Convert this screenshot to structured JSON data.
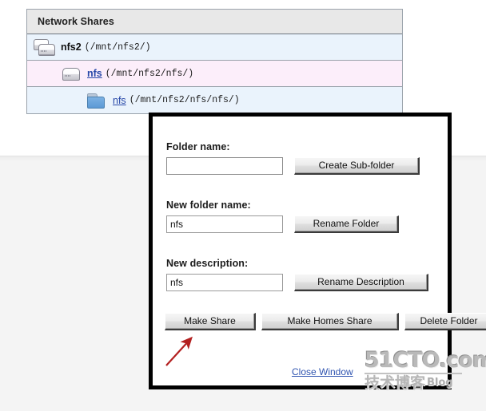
{
  "tree_panel": {
    "header": "Network Shares",
    "rows": [
      {
        "icon": "server-stack-icon",
        "name": "nfs2",
        "path": "(/mnt/nfs2/)",
        "style": "blue",
        "indent": 0,
        "is_link": false
      },
      {
        "icon": "server-icon",
        "name": "nfs",
        "path": "(/mnt/nfs2/nfs/)",
        "style": "pink",
        "indent": 1,
        "is_link": true
      },
      {
        "icon": "folder-icon",
        "name": "nfs",
        "path": "(/mnt/nfs2/nfs/nfs/)",
        "style": "blue",
        "indent": 2,
        "is_link": true
      }
    ]
  },
  "dialog": {
    "folder_name_label": "Folder name:",
    "folder_name_value": "",
    "create_subfolder_label": "Create Sub-folder",
    "new_folder_name_label": "New folder name:",
    "new_folder_name_value": "nfs",
    "rename_folder_label": "Rename Folder",
    "new_description_label": "New description:",
    "new_description_value": "nfs",
    "rename_description_label": "Rename Description",
    "make_share_label": "Make Share",
    "make_homes_share_label": "Make Homes Share",
    "delete_folder_label": "Delete Folder",
    "close_window_label": "Close Window"
  },
  "annotation": {
    "arrow_color": "#b32020"
  },
  "watermark": {
    "main": "51CTO.com",
    "sub": "技术博客",
    "blog": "Blog"
  },
  "colors": {
    "row_blue": "#eaf3fc",
    "row_pink": "#fceefa",
    "header_gray": "#e8e8e8",
    "link_blue": "#2747a8",
    "dialog_border": "#000000"
  }
}
